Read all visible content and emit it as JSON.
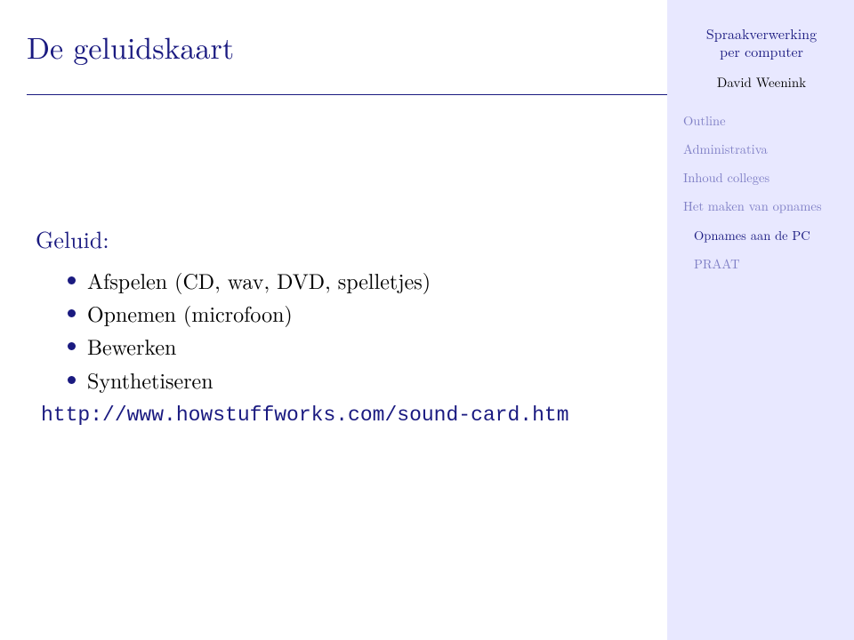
{
  "title": "De geluidskaart",
  "main": {
    "block_heading": "Geluid:",
    "items": [
      "Afspelen (CD, wav, DVD, spelletjes)",
      "Opnemen (microfoon)",
      "Bewerken",
      "Synthetiseren"
    ],
    "url": "http://www.howstuffworks.com/sound-card.htm"
  },
  "sidebar": {
    "course_title_line1": "Spraakverwerking",
    "course_title_line2": "per computer",
    "author": "David Weenink",
    "sections": [
      {
        "label": "Outline",
        "level": "top",
        "active": false
      },
      {
        "label": "Administrativa",
        "level": "top",
        "active": false
      },
      {
        "label": "Inhoud colleges",
        "level": "top",
        "active": false
      },
      {
        "label": "Het maken van opnames",
        "level": "top",
        "active": false
      },
      {
        "label": "Opnames aan de PC",
        "level": "sub",
        "active": true
      },
      {
        "label": "PRAAT",
        "level": "sub",
        "active": false
      }
    ]
  },
  "colors": {
    "accent": "#1a1a80",
    "sidebar_bg": "#e8e8ff",
    "inactive_link": "#8080c6"
  }
}
